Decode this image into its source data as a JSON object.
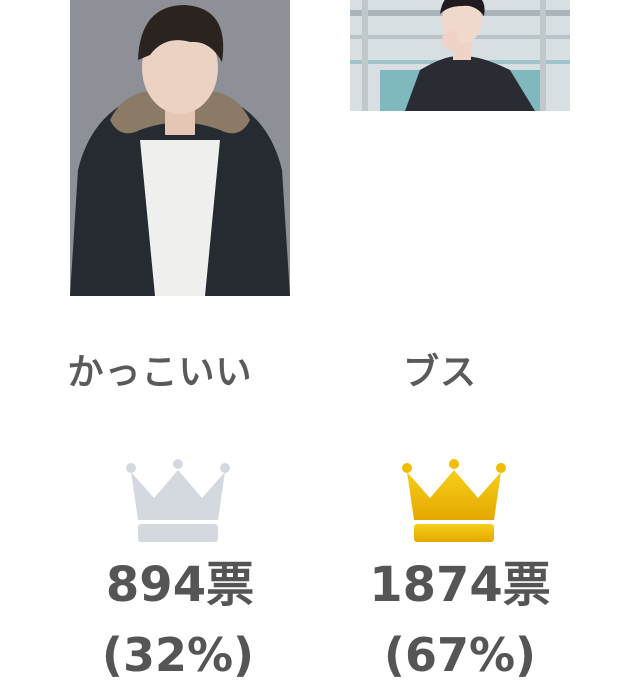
{
  "options": [
    {
      "label": "かっこいい",
      "votes": "894票",
      "percent": "(32%)",
      "crown": "silver-crown-icon",
      "crown_color": "#d4d8df"
    },
    {
      "label": "ブス",
      "votes": "1874票",
      "percent": "(67%)",
      "crown": "gold-crown-icon",
      "crown_color": "#f0bd00"
    }
  ]
}
